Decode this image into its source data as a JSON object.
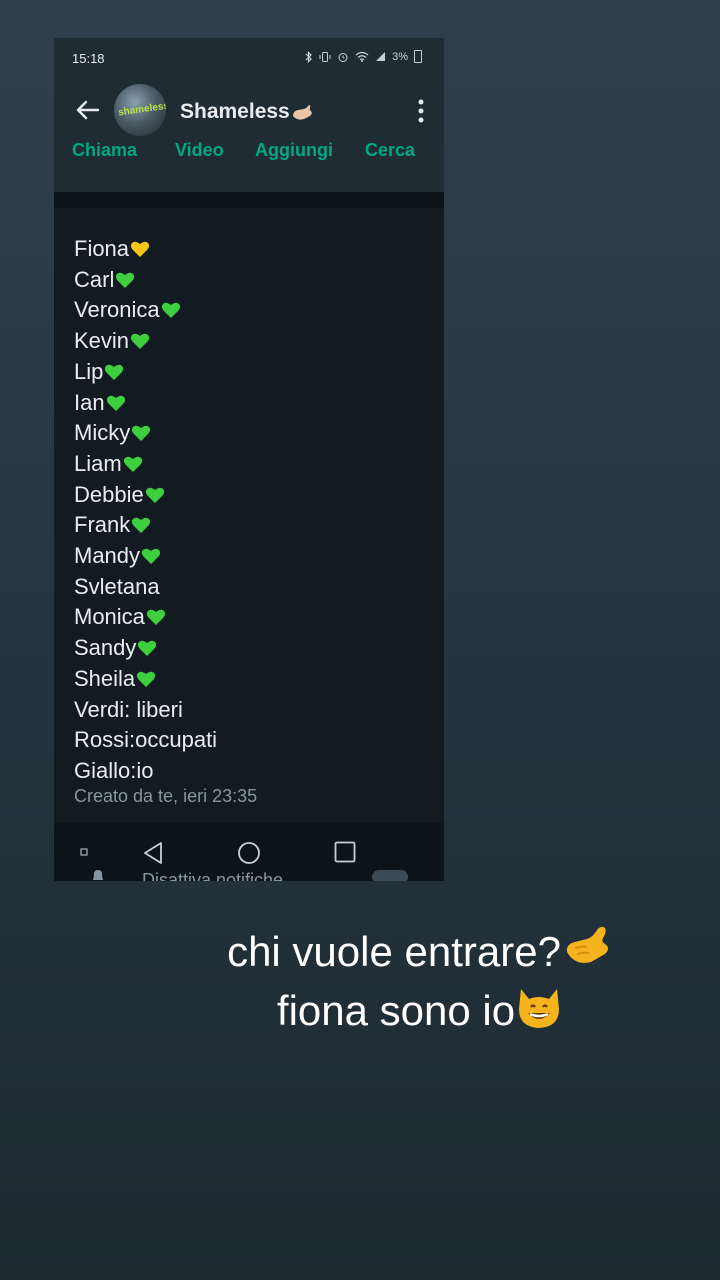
{
  "status_bar": {
    "time": "15:18",
    "battery": "3%"
  },
  "header": {
    "title": "Shameless",
    "avatar_text": "shameless"
  },
  "actions": [
    "Chiama",
    "Video",
    "Aggiungi",
    "Cerca"
  ],
  "description": {
    "lines": [
      {
        "text": "Fiona",
        "heart": "yellow"
      },
      {
        "text": "Carl",
        "heart": "green"
      },
      {
        "text": "Veronica",
        "heart": "green"
      },
      {
        "text": "Kevin",
        "heart": "green"
      },
      {
        "text": "Lip",
        "heart": "green"
      },
      {
        "text": "Ian",
        "heart": "green"
      },
      {
        "text": "Micky",
        "heart": "green"
      },
      {
        "text": "Liam",
        "heart": "green"
      },
      {
        "text": "Debbie",
        "heart": "green"
      },
      {
        "text": "Frank",
        "heart": "green"
      },
      {
        "text": "Mandy",
        "heart": "green"
      },
      {
        "text": "Svletana",
        "heart": ""
      },
      {
        "text": "Monica",
        "heart": "green"
      },
      {
        "text": "Sandy",
        "heart": "green"
      },
      {
        "text": "Sheila",
        "heart": "green"
      },
      {
        "text": "Verdi: liberi",
        "heart": ""
      },
      {
        "text": "Rossi:occupati",
        "heart": ""
      },
      {
        "text": "Giallo:io",
        "heart": ""
      }
    ]
  },
  "created_note": "Creato da te, ieri 23:35",
  "hidden_row": "Disattiva notifiche",
  "caption": {
    "line1": "chi vuole entrare?",
    "line2": "fiona sono io"
  },
  "colors": {
    "accent": "#00a884",
    "heart_green": "#3ecf3e",
    "heart_yellow": "#f5c518"
  }
}
